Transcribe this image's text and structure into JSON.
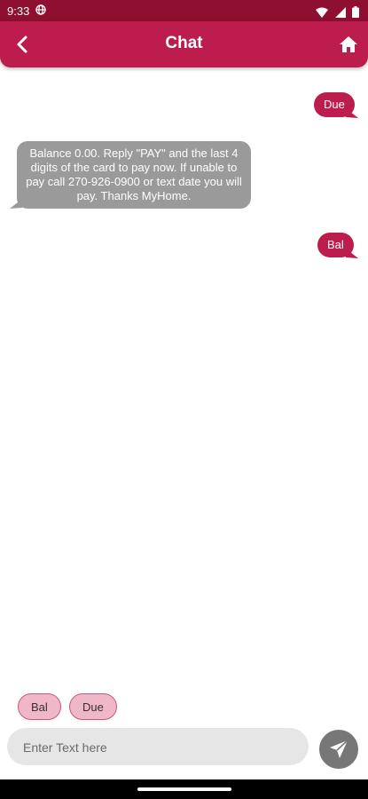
{
  "status_bar": {
    "time": "9:33"
  },
  "header": {
    "title": "Chat",
    "back_icon": "back-chevron-icon",
    "home_icon": "home-icon",
    "accent_color": "#bd1d4d"
  },
  "messages": [
    {
      "direction": "outgoing",
      "text": "Due"
    },
    {
      "direction": "incoming",
      "text": "Balance 0.00. Reply \"PAY\" and the last 4 digits of the card to pay now. If unable to pay call 270-926-0900 or text date you will pay. Thanks MyHome."
    },
    {
      "direction": "outgoing",
      "text": "Bal"
    }
  ],
  "quick_replies": [
    "Bal",
    "Due"
  ],
  "composer": {
    "placeholder": "Enter Text here",
    "value": "",
    "send_icon": "send-icon"
  }
}
